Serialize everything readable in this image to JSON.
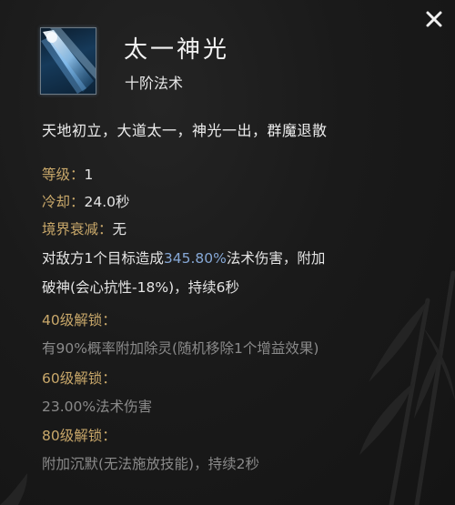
{
  "skill": {
    "name": "太一神光",
    "tier": "十阶法术",
    "flavor": "天地初立，大道太一，神光一出，群魔退散"
  },
  "stats": {
    "level_label": "等级：",
    "level_value": "1",
    "cooldown_label": "冷却：",
    "cooldown_value": "24.0秒",
    "decay_label": "境界衰减：",
    "decay_value": "无"
  },
  "effect": {
    "line1_pre": "对敌方1个目标造成",
    "line1_highlight": "345.80%",
    "line1_post": "法术伤害，附加",
    "line2": "破神(会心抗性-18%)，持续6秒"
  },
  "unlocks": [
    {
      "label": "40级解锁：",
      "text": "有90%概率附加除灵(随机移除1个增益效果)"
    },
    {
      "label": "60级解锁：",
      "text": "23.00%法术伤害"
    },
    {
      "label": "80级解锁：",
      "text": "附加沉默(无法施放技能)，持续2秒"
    }
  ],
  "icons": {
    "close": "close-icon",
    "skill": "skill-light-beam-icon"
  }
}
